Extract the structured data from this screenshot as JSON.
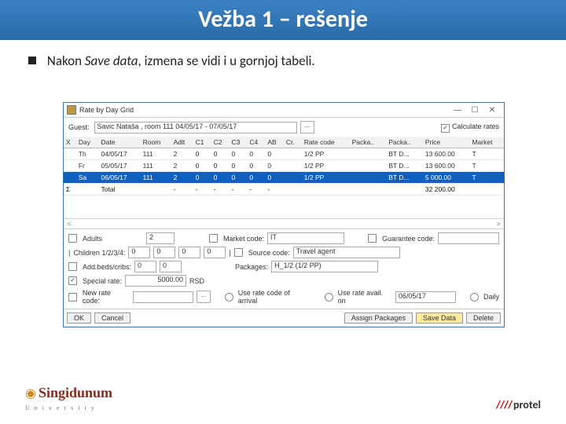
{
  "slide": {
    "title": "Vežba 1 – rešenje",
    "bullet_pre": "Nakon ",
    "bullet_em": "Save data",
    "bullet_post": ", izmena se vidi i u gornjoj tabeli."
  },
  "window": {
    "title": "Rate by Day Grid",
    "min": "—",
    "max": "☐",
    "close": "✕",
    "guest_label": "Guest:",
    "guest_value": "Savic Nataša , room 111  04/05/17 - 07/05/17",
    "dots": "...",
    "calc_label": "Calculate rates"
  },
  "grid": {
    "headers": [
      "X",
      "Day",
      "Date",
      "Room",
      "Adlt",
      "C1",
      "C2",
      "C3",
      "C4",
      "AB",
      "Cr.",
      "Rate code",
      "Packa..",
      "Packa..",
      "Price",
      "Market"
    ],
    "rows": [
      {
        "sel": false,
        "cells": [
          "",
          "Th",
          "04/05/17",
          "111",
          "2",
          "0",
          "0",
          "0",
          "0",
          "0",
          "",
          "1/2 PP",
          "",
          "BT D...",
          "13 600.00",
          "T"
        ]
      },
      {
        "sel": false,
        "cells": [
          "",
          "Fr",
          "05/05/17",
          "111",
          "2",
          "0",
          "0",
          "0",
          "0",
          "0",
          "",
          "1/2 PP",
          "",
          "BT D...",
          "13 600.00",
          "T"
        ]
      },
      {
        "sel": true,
        "cells": [
          "",
          "Sa",
          "06/05/17",
          "111",
          "2",
          "0",
          "0",
          "0",
          "0",
          "0",
          "",
          "1/2 PP",
          "",
          "BT D...",
          "5 000.00",
          "T"
        ]
      },
      {
        "sel": false,
        "total": true,
        "cells": [
          "Σ",
          "",
          "Total",
          "",
          "-",
          "-",
          "-",
          "-",
          "-",
          "-",
          "",
          "",
          "",
          "",
          "32 200.00",
          ""
        ]
      }
    ]
  },
  "form": {
    "adults_label": "Adults",
    "adults_val": "2",
    "market_label": "Market code:",
    "market_val": "IT",
    "guarantee_label": "Guarantee code:",
    "children_label": "Children 1/2/3/4:",
    "c1": "0",
    "c2": "0",
    "c3": "0",
    "c4": "0",
    "source_label": "Source code:",
    "source_val": "Travel agent",
    "addbeds_label": "Add.beds/cribs:",
    "ab1": "0",
    "ab2": "0",
    "packages_label": "Packages:",
    "packages_val": "H_1/2 (1/2 PP)",
    "special_label": "Special rate:",
    "special_val": "5000.00",
    "special_cur": "RSD",
    "newrate_label": "New rate code:",
    "opt1": "Use rate code of arrival",
    "opt2": "Use rate avail. on",
    "opt2_date": "06/05/17",
    "opt3": "Daily"
  },
  "buttons": {
    "ok": "OK",
    "cancel": "Cancel",
    "assign": "Assign Packages",
    "save": "Save Data",
    "delete": "Delete"
  },
  "logos": {
    "left": "Singidunum",
    "left_sub": "U n i v e r s i t y",
    "right": "protel"
  }
}
